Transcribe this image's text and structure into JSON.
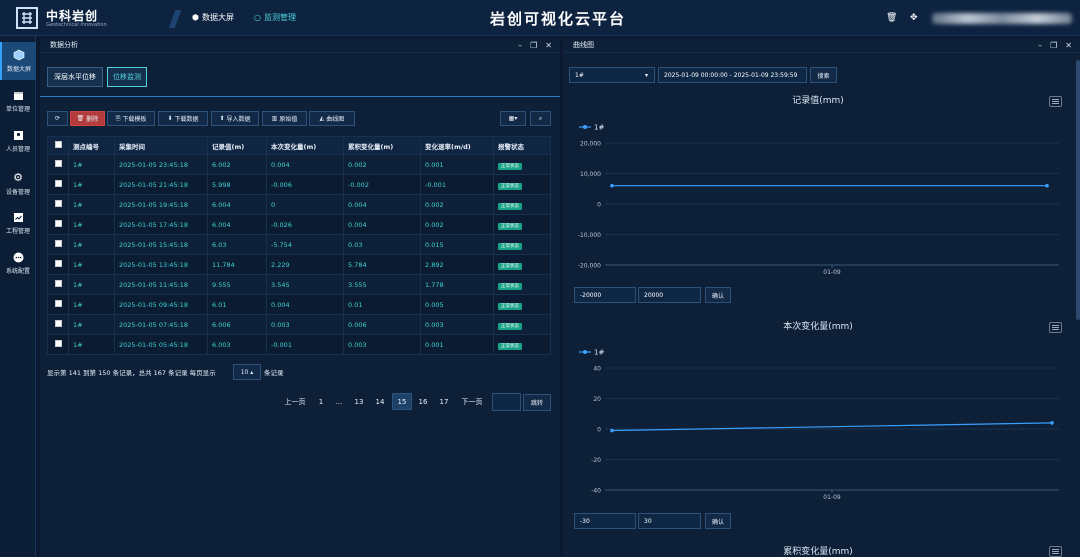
{
  "app": {
    "brand": "中科岩创",
    "brand_sub": "Geotechnical Innovation",
    "title": "岩创可视化云平台",
    "nav": [
      "数据大屏",
      "监测管理"
    ]
  },
  "sidebar": {
    "items": [
      {
        "label": "数据大屏",
        "icon": "cube-icon"
      },
      {
        "label": "单位管理",
        "icon": "calendar-icon"
      },
      {
        "label": "人员管理",
        "icon": "person-card-icon"
      },
      {
        "label": "设备管理",
        "icon": "gear-icon"
      },
      {
        "label": "工程管理",
        "icon": "chart-board-icon"
      },
      {
        "label": "系统配置",
        "icon": "dots-icon"
      }
    ]
  },
  "left_panel": {
    "title": "数据分析",
    "tabs": [
      "深层水平位移",
      "位移监测"
    ],
    "toolbar": {
      "delete": "删除",
      "download_template": "下载模板",
      "download_data": "下载数据",
      "import_data": "导入数据",
      "raw_value": "原始值",
      "curve": "曲线图"
    },
    "table": {
      "headers": [
        "测点编号",
        "采集时间",
        "记录值(m)",
        "本次变化量(m)",
        "累积变化量(m)",
        "变化速率(m/d)",
        "报警状态"
      ],
      "rows": [
        [
          "1#",
          "2025-01-05 23:45:18",
          "6.002",
          "0.004",
          "0.002",
          "0.001",
          "正常状态"
        ],
        [
          "1#",
          "2025-01-05 21:45:18",
          "5.998",
          "-0.006",
          "-0.002",
          "-0.001",
          "正常状态"
        ],
        [
          "1#",
          "2025-01-05 19:45:18",
          "6.004",
          "0",
          "0.004",
          "0.002",
          "正常状态"
        ],
        [
          "1#",
          "2025-01-05 17:45:18",
          "6.004",
          "-0.026",
          "0.004",
          "0.002",
          "正常状态"
        ],
        [
          "1#",
          "2025-01-05 15:45:18",
          "6.03",
          "-5.754",
          "0.03",
          "0.015",
          "正常状态"
        ],
        [
          "1#",
          "2025-01-05 13:45:18",
          "11.784",
          "2.229",
          "5.784",
          "2.892",
          "正常状态"
        ],
        [
          "1#",
          "2025-01-05 11:45:18",
          "9.555",
          "3.545",
          "3.555",
          "1.778",
          "正常状态"
        ],
        [
          "1#",
          "2025-01-05 09:45:18",
          "6.01",
          "0.004",
          "0.01",
          "0.005",
          "正常状态"
        ],
        [
          "1#",
          "2025-01-05 07:45:18",
          "6.006",
          "0.003",
          "0.006",
          "0.003",
          "正常状态"
        ],
        [
          "1#",
          "2025-01-05 05:45:18",
          "6.003",
          "-0.001",
          "0.003",
          "0.001",
          "正常状态"
        ]
      ]
    },
    "footer": {
      "summary": "显示第 141 到第 150 条记录，总共 167 条记录 每页显示",
      "page_size": "10 ▴",
      "unit": "条记录"
    },
    "pager": {
      "prev": "上一页",
      "pages": [
        "1",
        "...",
        "13",
        "14",
        "15",
        "16",
        "17"
      ],
      "active": "15",
      "next": "下一页",
      "jump": "跳转"
    }
  },
  "right_panel": {
    "title": "曲线图",
    "point_select": "1#",
    "date_range": "2025-01-09 00:00:00 - 2025-01-09 23:59:59",
    "search": "搜索",
    "confirm": "确认"
  },
  "chart_data": [
    {
      "type": "line",
      "title": "记录值(mm)",
      "series": [
        {
          "name": "1#",
          "x": [
            "01-09"
          ],
          "values": [
            6000
          ]
        }
      ],
      "ylim": [
        -20000,
        20000
      ],
      "yticks": [
        "20,000",
        "10,000",
        "0",
        "-10,000",
        "-20,000"
      ],
      "xticks": [
        "01-09"
      ],
      "range_inputs": [
        "-20000",
        "20000"
      ],
      "color": "#3aa0ff"
    },
    {
      "type": "line",
      "title": "本次变化量(mm)",
      "series": [
        {
          "name": "1#",
          "x": [
            "01-09 start",
            "01-09 end"
          ],
          "values": [
            -1,
            4
          ]
        }
      ],
      "ylim": [
        -40,
        40
      ],
      "yticks": [
        "40",
        "20",
        "0",
        "-20",
        "-40"
      ],
      "xticks": [
        "01-09"
      ],
      "range_inputs": [
        "-30",
        "30"
      ],
      "color": "#3aa0ff"
    },
    {
      "type": "line",
      "title": "累积变化量(mm)"
    }
  ]
}
